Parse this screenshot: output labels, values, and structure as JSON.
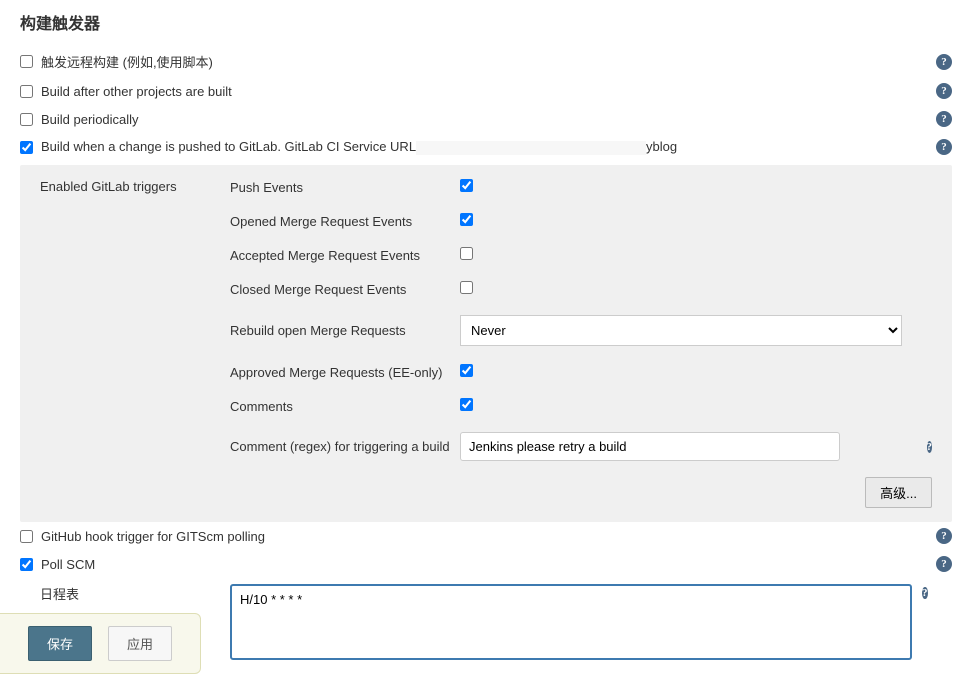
{
  "header": {
    "title": "构建触发器"
  },
  "triggers": {
    "remote": {
      "label": "触发远程构建 (例如,使用脚本)",
      "checked": false
    },
    "after_projects": {
      "label": "Build after other projects are built",
      "checked": false
    },
    "periodically": {
      "label": "Build periodically",
      "checked": false
    },
    "gitlab_push": {
      "label_prefix": "Build when a change is pushed to GitLab. GitLab CI Service URL",
      "label_suffix": "yblog",
      "checked": true
    },
    "github_hook": {
      "label": "GitHub hook trigger for GITScm polling",
      "checked": false
    },
    "poll_scm": {
      "label": "Poll SCM",
      "checked": true
    }
  },
  "gitlab": {
    "section_label": "Enabled GitLab triggers",
    "push_events": {
      "label": "Push Events",
      "checked": true
    },
    "opened_mr": {
      "label": "Opened Merge Request Events",
      "checked": true
    },
    "accepted_mr": {
      "label": "Accepted Merge Request Events",
      "checked": false
    },
    "closed_mr": {
      "label": "Closed Merge Request Events",
      "checked": false
    },
    "rebuild_open_mr": {
      "label": "Rebuild open Merge Requests",
      "value": "Never"
    },
    "approved_mr": {
      "label": "Approved Merge Requests (EE-only)",
      "checked": true
    },
    "comments": {
      "label": "Comments",
      "checked": true
    },
    "comment_regex": {
      "label": "Comment (regex) for triggering a build",
      "value": "Jenkins please retry a build"
    },
    "advanced_button": "高级..."
  },
  "schedule": {
    "label": "日程表",
    "value": "H/10 * * * *"
  },
  "footer": {
    "save": "保存",
    "apply": "应用"
  },
  "icons": {
    "help": "?"
  }
}
